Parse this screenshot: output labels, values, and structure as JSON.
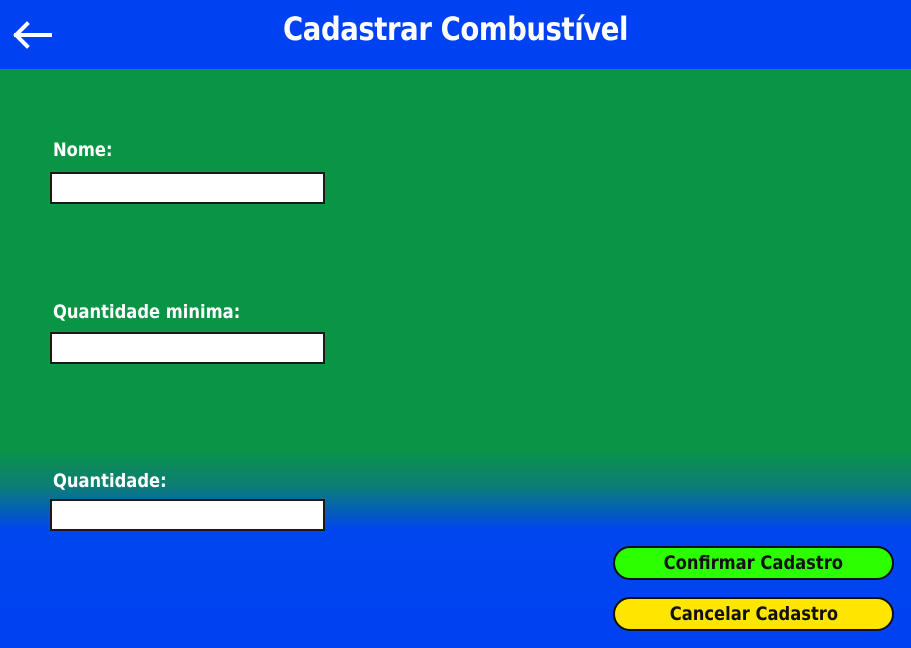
{
  "header": {
    "title": "Cadastrar Combustível",
    "back_icon": "arrow-left-icon"
  },
  "form": {
    "nome": {
      "label": "Nome:",
      "value": ""
    },
    "quantidade_minima": {
      "label": "Quantidade minima:",
      "value": ""
    },
    "quantidade": {
      "label": "Quantidade:",
      "value": ""
    }
  },
  "actions": {
    "confirm_label": "Confirmar Cadastro",
    "cancel_label": "Cancelar Cadastro"
  },
  "colors": {
    "header": "#0041f2",
    "form_background": "#0a9445",
    "confirm_button": "#2cff00",
    "cancel_button": "#ffe600"
  }
}
